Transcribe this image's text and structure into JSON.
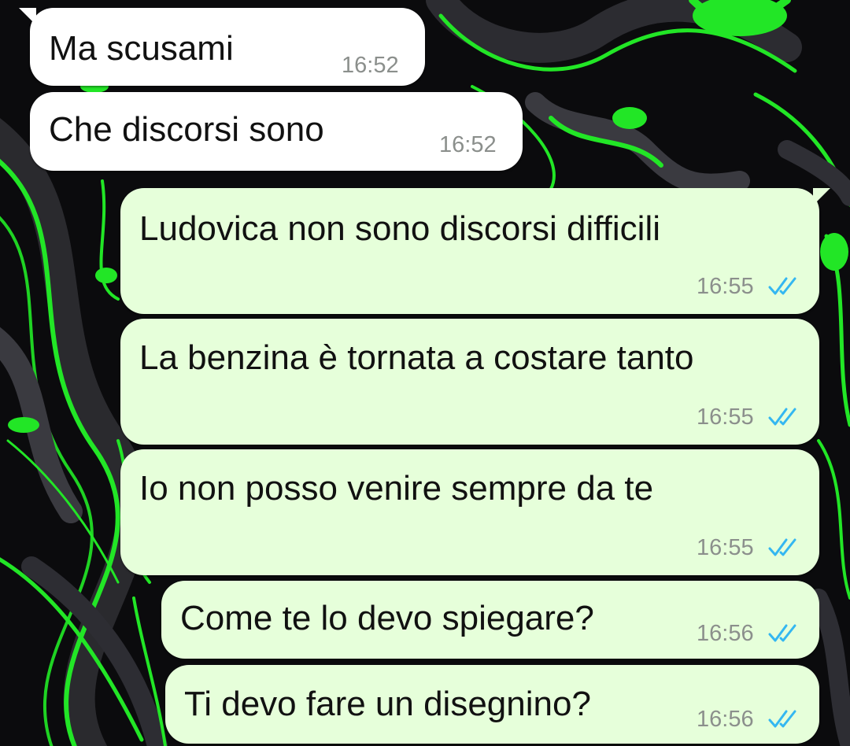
{
  "chat": {
    "messages": [
      {
        "direction": "incoming",
        "text": "Ma scusami",
        "time": "16:52"
      },
      {
        "direction": "incoming",
        "text": "Che discorsi sono",
        "time": "16:52"
      },
      {
        "direction": "outgoing",
        "text": "Ludovica non sono discorsi difficili",
        "time": "16:55",
        "status": "read-receipt-icon"
      },
      {
        "direction": "outgoing",
        "text": "La benzina è tornata a costare tanto",
        "time": "16:55",
        "status": "read-receipt-icon"
      },
      {
        "direction": "outgoing",
        "text": "Io non posso venire sempre da te",
        "time": "16:55",
        "status": "read-receipt-icon"
      },
      {
        "direction": "outgoing",
        "text": "Come te lo devo spiegare?",
        "time": "16:56",
        "status": "read-receipt-icon"
      },
      {
        "direction": "outgoing",
        "text": "Ti devo fare un disegnino?",
        "time": "16:56",
        "status": "read-receipt-icon"
      }
    ]
  },
  "colors": {
    "incoming_bubble": "#ffffff",
    "outgoing_bubble": "#e6ffda",
    "read_tick": "#34b7f1",
    "wallpaper_green": "#22e626",
    "wallpaper_dark": "#0b0b0d"
  }
}
